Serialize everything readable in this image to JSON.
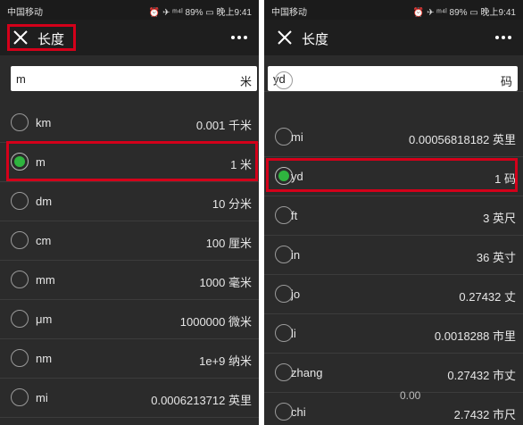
{
  "left_panel": {
    "status": {
      "carrier": "中国移动",
      "right_text": "⏰ ✈ ᵐ⁴ˡ 89% ▭ 晚上9:41"
    },
    "title": "长度",
    "input": {
      "value": "m",
      "unit": "米"
    },
    "selected_index": 1,
    "rows": [
      {
        "name": "km",
        "value": "0.001 千米"
      },
      {
        "name": "m",
        "value": "1 米"
      },
      {
        "name": "dm",
        "value": "10 分米"
      },
      {
        "name": "cm",
        "value": "100 厘米"
      },
      {
        "name": "mm",
        "value": "1000 毫米"
      },
      {
        "name": "μm",
        "value": "1000000 微米"
      },
      {
        "name": "nm",
        "value": "1e+9 纳米"
      },
      {
        "name": "mi",
        "value": "0.0006213712 英里"
      }
    ]
  },
  "right_panel": {
    "status": {
      "carrier": "中国移动",
      "right_text": "⏰ ✈ ᵐ⁴ˡ 89% ▭ 晚上9:41"
    },
    "title": "长度",
    "input": {
      "value": "yd",
      "unit": "码"
    },
    "selected_index": 1,
    "rows": [
      {
        "name": "mi",
        "value": "0.00056818182 英里"
      },
      {
        "name": "yd",
        "value": "1 码"
      },
      {
        "name": "ft",
        "value": "3 英尺"
      },
      {
        "name": "in",
        "value": "36 英寸"
      },
      {
        "name": "jo",
        "value": "0.27432 丈"
      },
      {
        "name": "li",
        "value": "0.0018288 市里"
      },
      {
        "name": "zhang",
        "value": "0.27432 市丈"
      },
      {
        "name": "chi",
        "value": "2.7432 市尺"
      }
    ],
    "ghost_text": "0.00"
  },
  "colors": {
    "highlight": "#d4001a",
    "radio_checked": "#2fb53f",
    "background": "#2b2b2b"
  }
}
